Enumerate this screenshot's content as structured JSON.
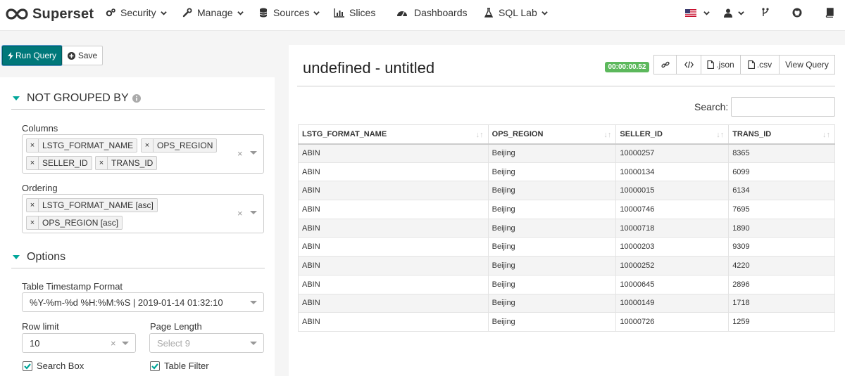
{
  "nav": {
    "brand": "Superset",
    "items": [
      {
        "label": "Security",
        "icon": "cogs-icon",
        "caret": true
      },
      {
        "label": "Manage",
        "icon": "wrench-icon",
        "caret": true
      },
      {
        "label": "Sources",
        "icon": "database-icon",
        "caret": true
      },
      {
        "label": "Slices",
        "icon": "bar-chart-icon",
        "caret": false
      },
      {
        "label": "Dashboards",
        "icon": "dashboard-icon",
        "caret": false
      },
      {
        "label": "SQL Lab",
        "icon": "flask-icon",
        "caret": true
      }
    ],
    "right_icons": [
      "us-flag-icon",
      "user-icon",
      "code-fork-icon",
      "github-icon",
      "book-icon"
    ]
  },
  "query_buttons": {
    "run": "Run Query",
    "save": "Save"
  },
  "sections": {
    "not_grouped_by": "NOT GROUPED BY",
    "options": "Options"
  },
  "columns": {
    "label": "Columns",
    "tags": [
      "LSTG_FORMAT_NAME",
      "OPS_REGION",
      "SELLER_ID",
      "TRANS_ID"
    ]
  },
  "ordering": {
    "label": "Ordering",
    "tags": [
      "LSTG_FORMAT_NAME [asc]",
      "OPS_REGION [asc]"
    ]
  },
  "timestamp_format": {
    "label": "Table Timestamp Format",
    "value": "%Y-%m-%d %H:%M:%S | 2019-01-14 01:32:10"
  },
  "row_limit": {
    "label": "Row limit",
    "value": "10"
  },
  "page_length": {
    "label": "Page Length",
    "placeholder": "Select 9"
  },
  "checkboxes": {
    "search_box": "Search Box",
    "table_filter": "Table Filter"
  },
  "result": {
    "title": "undefined - untitled",
    "timer": "00:00:00.52",
    "buttons": {
      "json": ".json",
      "csv": ".csv",
      "view_query": "View Query"
    },
    "search_label": "Search:",
    "headers": [
      "LSTG_FORMAT_NAME",
      "OPS_REGION",
      "SELLER_ID",
      "TRANS_ID"
    ],
    "rows": [
      [
        "ABIN",
        "Beijing",
        "10000257",
        "8365"
      ],
      [
        "ABIN",
        "Beijing",
        "10000134",
        "6099"
      ],
      [
        "ABIN",
        "Beijing",
        "10000015",
        "6134"
      ],
      [
        "ABIN",
        "Beijing",
        "10000746",
        "7695"
      ],
      [
        "ABIN",
        "Beijing",
        "10000718",
        "1890"
      ],
      [
        "ABIN",
        "Beijing",
        "10000203",
        "9309"
      ],
      [
        "ABIN",
        "Beijing",
        "10000252",
        "4220"
      ],
      [
        "ABIN",
        "Beijing",
        "10000645",
        "2896"
      ],
      [
        "ABIN",
        "Beijing",
        "10000149",
        "1718"
      ],
      [
        "ABIN",
        "Beijing",
        "10000726",
        "1259"
      ]
    ]
  },
  "colors": {
    "run_button": "#00787a",
    "accent": "#00a699",
    "timer": "#5cb85c"
  }
}
